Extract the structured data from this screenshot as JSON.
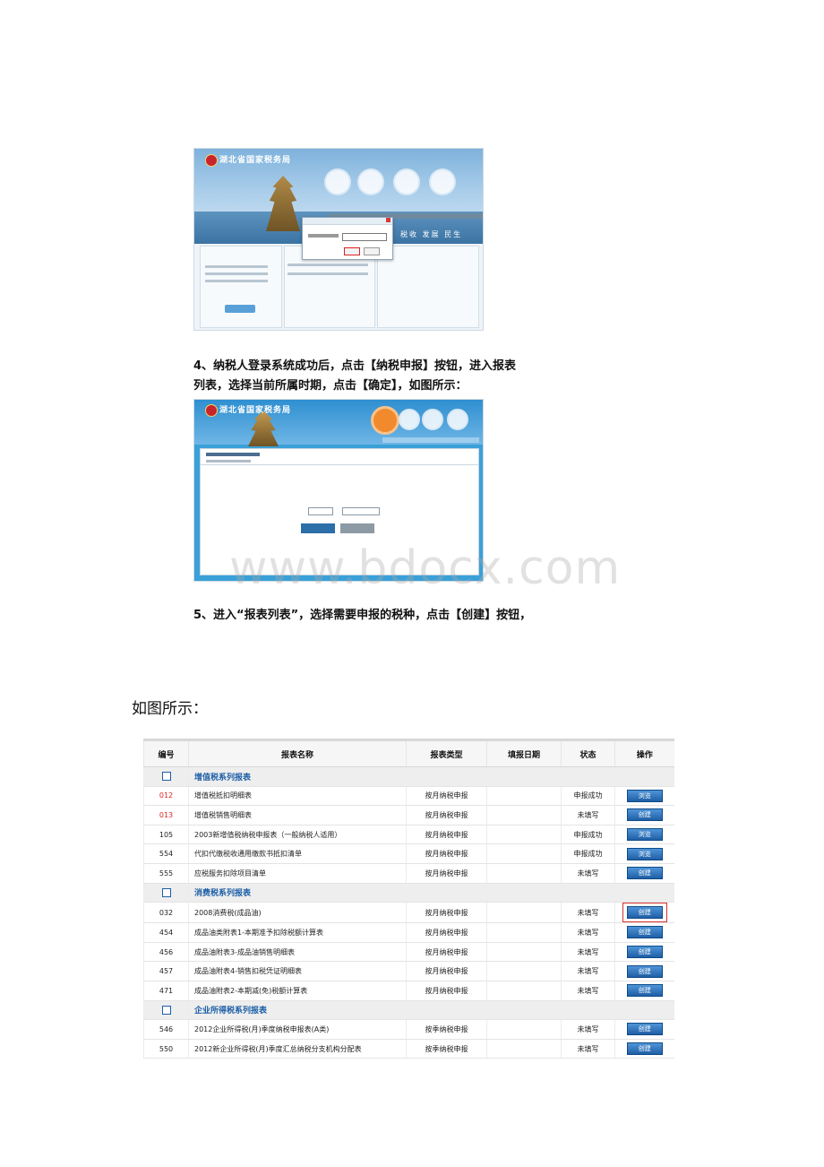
{
  "login_shot": {
    "title": "湖北省国家税务局",
    "slogan": "税收 发展 民生"
  },
  "steps": {
    "step4_line1": "4、纳税人登录系统成功后，点击【纳税申报】按钮，进入报表",
    "step4_line2": "列表，选择当前所属时期，点击【确定】，如图所示：",
    "step5": "5、进入“报表列表”，选择需要申报的税种，点击【创建】按钮，"
  },
  "list_shot": {
    "title": "湖北省国家税务局"
  },
  "watermark": "www.bdocx.com",
  "caption": "如图所示：",
  "table": {
    "headers": [
      "编号",
      "报表名称",
      "报表类型",
      "填报日期",
      "状态",
      "操作"
    ],
    "groups": [
      {
        "name": "增值税系列报表",
        "rows": [
          {
            "code": "012",
            "name": "增值税抵扣明细表",
            "type": "按月纳税申报",
            "date": "",
            "status": "申报成功",
            "action": "浏览"
          },
          {
            "code": "013",
            "name": "增值税销售明细表",
            "type": "按月纳税申报",
            "date": "",
            "status": "未填写",
            "action": "创建"
          },
          {
            "code": "105",
            "name": "2003新增值税纳税申报表（一般纳税人适用）",
            "type": "按月纳税申报",
            "date": "",
            "status": "申报成功",
            "action": "浏览"
          },
          {
            "code": "554",
            "name": "代扣代缴税收通用缴款书抵扣清单",
            "type": "按月纳税申报",
            "date": "",
            "status": "申报成功",
            "action": "浏览"
          },
          {
            "code": "555",
            "name": "应税服务扣除项目清单",
            "type": "按月纳税申报",
            "date": "",
            "status": "未填写",
            "action": "创建"
          }
        ]
      },
      {
        "name": "消费税系列报表",
        "rows": [
          {
            "code": "032",
            "name": "2008消费税(成品油)",
            "type": "按月纳税申报",
            "date": "",
            "status": "未填写",
            "action": "创建"
          },
          {
            "code": "454",
            "name": "成品油类附表1-本期准予扣除税额计算表",
            "type": "按月纳税申报",
            "date": "",
            "status": "未填写",
            "action": "创建"
          },
          {
            "code": "456",
            "name": "成品油附表3-成品油销售明细表",
            "type": "按月纳税申报",
            "date": "",
            "status": "未填写",
            "action": "创建"
          },
          {
            "code": "457",
            "name": "成品油附表4-销售扣税凭证明细表",
            "type": "按月纳税申报",
            "date": "",
            "status": "未填写",
            "action": "创建"
          },
          {
            "code": "471",
            "name": "成品油附表2-本期减(免)税额计算表",
            "type": "按月纳税申报",
            "date": "",
            "status": "未填写",
            "action": "创建"
          }
        ]
      },
      {
        "name": "企业所得税系列报表",
        "rows": [
          {
            "code": "546",
            "name": "2012企业所得税(月)季度纳税申报表(A类)",
            "type": "按季纳税申报",
            "date": "",
            "status": "未填写",
            "action": "创建"
          },
          {
            "code": "550",
            "name": "2012新企业所得税(月)季度汇总纳税分支机构分配表",
            "type": "按季纳税申报",
            "date": "",
            "status": "未填写",
            "action": "创建"
          }
        ]
      }
    ]
  }
}
